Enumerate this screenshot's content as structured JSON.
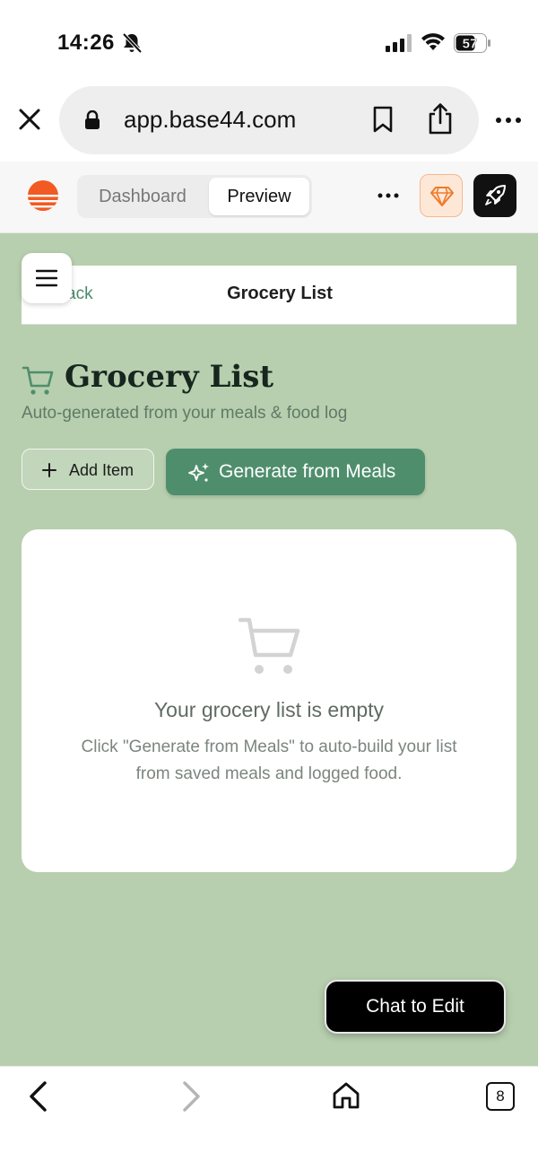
{
  "status_bar": {
    "time": "14:26",
    "battery": "57"
  },
  "browser": {
    "url": "app.base44.com",
    "tab_count": "8"
  },
  "app_toolbar": {
    "tabs": [
      {
        "label": "Dashboard",
        "active": false
      },
      {
        "label": "Preview",
        "active": true
      }
    ]
  },
  "app": {
    "header": {
      "back_label": "ack",
      "title": "Grocery List"
    },
    "page": {
      "title": "Grocery List",
      "subtitle": "Auto-generated from your meals & food log"
    },
    "actions": {
      "add_item_label": "Add Item",
      "generate_label": "Generate from Meals"
    },
    "empty_state": {
      "title": "Your grocery list is empty",
      "description": "Click \"Generate from Meals\" to auto-build your list from saved meals and logged food."
    },
    "chat_button_label": "Chat to Edit"
  },
  "colors": {
    "content_bg": "#b7cfae",
    "accent_green": "#4f8e6d",
    "logo_orange": "#f15a22"
  },
  "icons": {
    "status": [
      "bell-slash-icon",
      "signal-icon",
      "wifi-icon",
      "battery-icon"
    ],
    "browser": [
      "close-icon",
      "lock-icon",
      "bookmark-icon",
      "share-icon",
      "more-icon"
    ],
    "toolbar": [
      "app-logo-icon",
      "more-icon",
      "gem-icon",
      "rocket-icon"
    ],
    "page": [
      "hamburger-menu-icon",
      "shopping-cart-icon",
      "plus-icon",
      "sparkles-icon"
    ],
    "bottom": [
      "back-arrow-icon",
      "forward-arrow-icon",
      "home-icon",
      "tabs-icon"
    ]
  }
}
